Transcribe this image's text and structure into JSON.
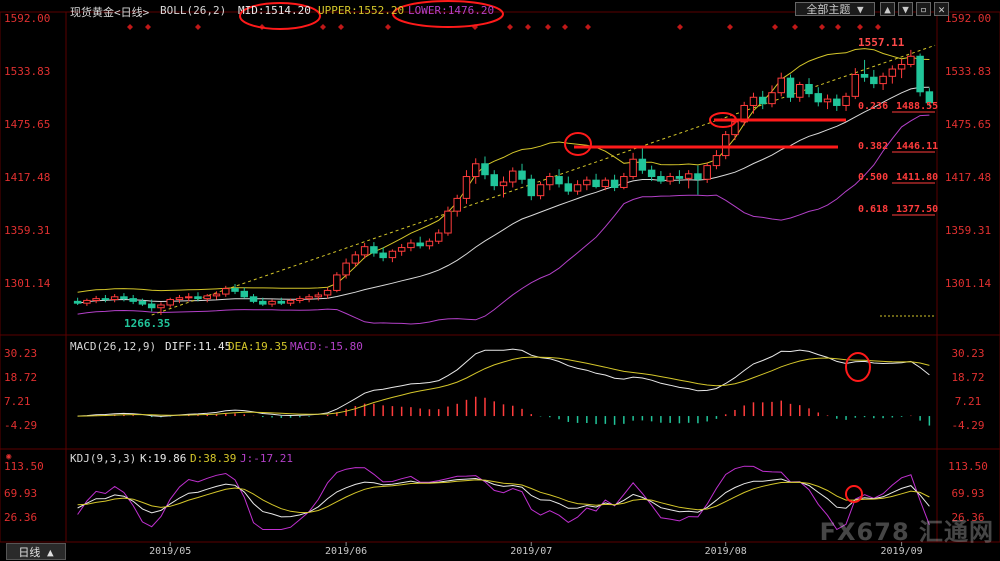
{
  "colors": {
    "up": "#ff3c3c",
    "down": "#21c59a",
    "mid": "#d8d8d8",
    "upper": "#d4c62a",
    "lower": "#b340c8",
    "dea": "#d4c62a",
    "diff": "#e8e8e8",
    "macd": "#b340c8",
    "k": "#e8e8e8",
    "d": "#d4c62a",
    "j": "#c030d0",
    "grid": "#5a0000",
    "axis": "#e03030"
  },
  "header": {
    "title": "现货黄金<日线>",
    "indicator": "BOLL(26,2)",
    "mid": "MID:1514.20",
    "upper": "UPPER:1552.20",
    "lower": "LOWER:1476.20",
    "theme_button": "全部主题 ▼"
  },
  "price_axis": [
    "1592.00",
    "1533.83",
    "1475.65",
    "1417.48",
    "1359.31",
    "1301.14"
  ],
  "macd_header": {
    "name": "MACD(26,12,9)",
    "diff": "DIFF:11.45",
    "dea": "DEA:19.35",
    "macd": "MACD:-15.80"
  },
  "macd_axis": [
    "30.23",
    "18.72",
    "7.21",
    "-4.29"
  ],
  "kdj_header": {
    "name": "KDJ(9,3,3)",
    "k": "K:19.86",
    "d": "D:38.39",
    "j": "J:-17.21"
  },
  "kdj_axis": [
    "113.50",
    "69.93",
    "26.36"
  ],
  "date_labels": [
    "2019/05",
    "2019/06",
    "2019/07",
    "2019/08",
    "2019/09"
  ],
  "annotations": {
    "high": "1557.11",
    "low": "1266.35"
  },
  "fib_levels": [
    {
      "ratio": "0.236",
      "price": "1488.55"
    },
    {
      "ratio": "0.382",
      "price": "1446.11"
    },
    {
      "ratio": "0.500",
      "price": "1411.80"
    },
    {
      "ratio": "0.618",
      "price": "1377.50"
    }
  ],
  "bottom_tab": "日线 ▲",
  "watermark": "FX678 汇通网",
  "chart_data": {
    "type": "candlestick",
    "title": "现货黄金<日线>",
    "ylim": [
      1250,
      1600
    ],
    "x_labels": [
      "2019/05",
      "2019/06",
      "2019/07",
      "2019/08",
      "2019/09"
    ],
    "ohlc": [
      [
        1281,
        1285,
        1277,
        1279
      ],
      [
        1279,
        1284,
        1276,
        1282
      ],
      [
        1282,
        1287,
        1279,
        1284
      ],
      [
        1284,
        1288,
        1280,
        1283
      ],
      [
        1283,
        1289,
        1280,
        1286
      ],
      [
        1286,
        1290,
        1281,
        1284
      ],
      [
        1284,
        1288,
        1278,
        1281
      ],
      [
        1281,
        1284,
        1276,
        1278
      ],
      [
        1278,
        1283,
        1270,
        1274
      ],
      [
        1274,
        1280,
        1266,
        1277
      ],
      [
        1277,
        1285,
        1274,
        1283
      ],
      [
        1283,
        1288,
        1279,
        1285
      ],
      [
        1285,
        1290,
        1281,
        1286
      ],
      [
        1286,
        1291,
        1281,
        1284
      ],
      [
        1284,
        1289,
        1280,
        1287
      ],
      [
        1287,
        1292,
        1283,
        1289
      ],
      [
        1289,
        1298,
        1286,
        1295
      ],
      [
        1295,
        1300,
        1289,
        1292
      ],
      [
        1292,
        1296,
        1284,
        1286
      ],
      [
        1286,
        1289,
        1279,
        1281
      ],
      [
        1281,
        1285,
        1276,
        1278
      ],
      [
        1278,
        1283,
        1275,
        1281
      ],
      [
        1281,
        1285,
        1277,
        1279
      ],
      [
        1279,
        1284,
        1276,
        1282
      ],
      [
        1282,
        1287,
        1279,
        1284
      ],
      [
        1284,
        1289,
        1280,
        1286
      ],
      [
        1286,
        1291,
        1282,
        1288
      ],
      [
        1288,
        1296,
        1284,
        1293
      ],
      [
        1293,
        1313,
        1291,
        1310
      ],
      [
        1310,
        1328,
        1306,
        1323
      ],
      [
        1323,
        1336,
        1319,
        1332
      ],
      [
        1332,
        1345,
        1328,
        1341
      ],
      [
        1341,
        1346,
        1330,
        1334
      ],
      [
        1334,
        1340,
        1325,
        1329
      ],
      [
        1329,
        1338,
        1324,
        1336
      ],
      [
        1336,
        1344,
        1331,
        1340
      ],
      [
        1340,
        1349,
        1336,
        1345
      ],
      [
        1345,
        1352,
        1339,
        1342
      ],
      [
        1342,
        1350,
        1338,
        1347
      ],
      [
        1347,
        1360,
        1344,
        1356
      ],
      [
        1356,
        1385,
        1353,
        1380
      ],
      [
        1380,
        1398,
        1374,
        1394
      ],
      [
        1394,
        1425,
        1388,
        1418
      ],
      [
        1418,
        1438,
        1410,
        1432
      ],
      [
        1432,
        1440,
        1415,
        1420
      ],
      [
        1420,
        1425,
        1403,
        1408
      ],
      [
        1408,
        1418,
        1395,
        1412
      ],
      [
        1412,
        1428,
        1406,
        1424
      ],
      [
        1424,
        1432,
        1410,
        1415
      ],
      [
        1415,
        1420,
        1392,
        1397
      ],
      [
        1397,
        1412,
        1393,
        1409
      ],
      [
        1409,
        1422,
        1403,
        1418
      ],
      [
        1418,
        1426,
        1406,
        1410
      ],
      [
        1410,
        1418,
        1398,
        1402
      ],
      [
        1402,
        1414,
        1398,
        1409
      ],
      [
        1409,
        1418,
        1403,
        1414
      ],
      [
        1414,
        1421,
        1405,
        1407
      ],
      [
        1407,
        1417,
        1403,
        1414
      ],
      [
        1414,
        1420,
        1402,
        1406
      ],
      [
        1406,
        1422,
        1404,
        1418
      ],
      [
        1418,
        1444,
        1415,
        1437
      ],
      [
        1437,
        1452,
        1421,
        1425
      ],
      [
        1425,
        1430,
        1413,
        1418
      ],
      [
        1418,
        1424,
        1410,
        1413
      ],
      [
        1413,
        1422,
        1409,
        1418
      ],
      [
        1418,
        1425,
        1410,
        1416
      ],
      [
        1416,
        1425,
        1405,
        1421
      ],
      [
        1421,
        1430,
        1398,
        1415
      ],
      [
        1415,
        1433,
        1411,
        1430
      ],
      [
        1430,
        1447,
        1426,
        1441
      ],
      [
        1441,
        1468,
        1437,
        1464
      ],
      [
        1464,
        1483,
        1458,
        1478
      ],
      [
        1478,
        1500,
        1474,
        1496
      ],
      [
        1496,
        1510,
        1487,
        1505
      ],
      [
        1505,
        1512,
        1492,
        1498
      ],
      [
        1498,
        1518,
        1494,
        1510
      ],
      [
        1510,
        1532,
        1506,
        1526
      ],
      [
        1526,
        1530,
        1500,
        1505
      ],
      [
        1505,
        1522,
        1500,
        1519
      ],
      [
        1519,
        1526,
        1505,
        1509
      ],
      [
        1509,
        1516,
        1495,
        1500
      ],
      [
        1500,
        1508,
        1492,
        1503
      ],
      [
        1503,
        1508,
        1490,
        1496
      ],
      [
        1496,
        1510,
        1490,
        1506
      ],
      [
        1506,
        1537,
        1503,
        1530
      ],
      [
        1530,
        1546,
        1522,
        1527
      ],
      [
        1527,
        1535,
        1515,
        1520
      ],
      [
        1520,
        1532,
        1513,
        1528
      ],
      [
        1528,
        1540,
        1520,
        1536
      ],
      [
        1536,
        1547,
        1526,
        1541
      ],
      [
        1541,
        1557,
        1538,
        1550
      ],
      [
        1550,
        1553,
        1506,
        1511
      ],
      [
        1511,
        1515,
        1495,
        1499
      ]
    ],
    "date_label_index": [
      10,
      29,
      49,
      70,
      89
    ],
    "fibonacci": [
      {
        "ratio": 0.236,
        "price": 1488.55
      },
      {
        "ratio": 0.382,
        "price": 1446.11
      },
      {
        "ratio": 0.5,
        "price": 1411.8
      },
      {
        "ratio": 0.618,
        "price": 1377.5
      }
    ],
    "high": 1557.11,
    "low": 1266.35,
    "boll_last": {
      "mid": 1514.2,
      "upper": 1552.2,
      "lower": 1476.2
    },
    "macd_last": {
      "diff": 11.45,
      "dea": 19.35,
      "macd": -15.8
    },
    "kdj_last": {
      "k": 19.86,
      "d": 38.39,
      "j": -17.21
    }
  }
}
